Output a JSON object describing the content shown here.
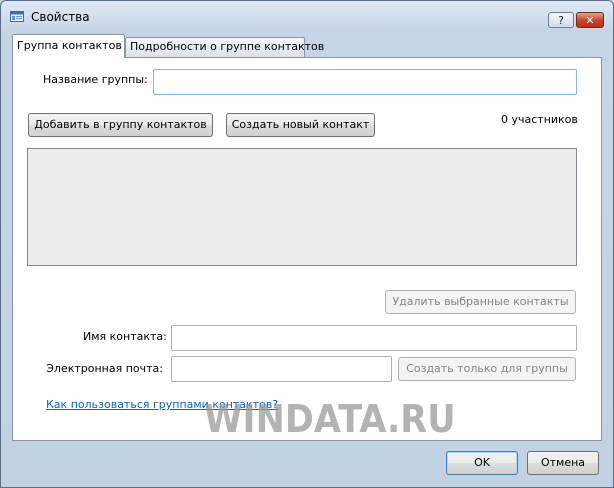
{
  "window": {
    "title": "Свойства",
    "help_label": "?",
    "close_label": "✕"
  },
  "tabs": [
    {
      "label": "Группа контактов",
      "active": true
    },
    {
      "label": "Подробности о группе контактов",
      "active": false
    }
  ],
  "form": {
    "group_name_label": "Название группы:",
    "group_name_value": "",
    "add_to_group_button": "Добавить в группу контактов",
    "create_contact_button": "Создать новый контакт",
    "members_count": "0 участников",
    "members_list": [],
    "remove_selected_button": "Удалить выбранные контакты",
    "contact_name_label": "Имя контакта:",
    "contact_name_value": "",
    "email_label": "Электронная почта:",
    "email_value": "",
    "create_for_group_button": "Создать только для группы",
    "help_link": "Как пользоваться группами контактов?"
  },
  "footer": {
    "ok_button": "OK",
    "cancel_button": "Отмена"
  },
  "watermark": "WINDATA.RU",
  "colors": {
    "window_frame": "#c6d5e6",
    "link": "#0066cc",
    "disabled_text": "#838383"
  }
}
